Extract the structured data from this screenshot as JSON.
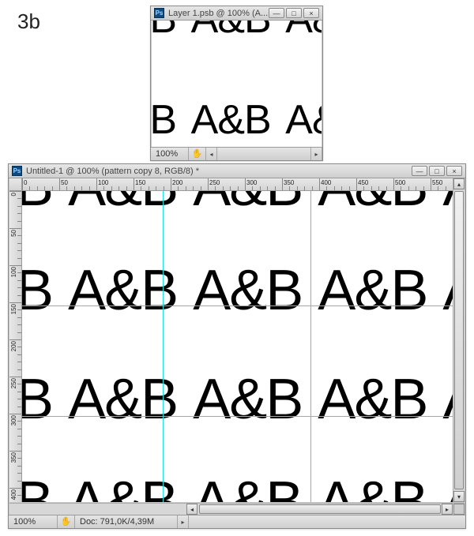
{
  "step_label": "3b",
  "pattern_text": "A&B",
  "small_window": {
    "title": "Layer 1.psb @ 100% (A...",
    "zoom": "100%"
  },
  "big_window": {
    "title": "Untitled-1 @ 100% (pattern copy 8, RGB/8) *",
    "zoom": "100%",
    "doc_info": "Doc: 791,0K/4,39M",
    "ruler_h_labels": [
      "0",
      "50",
      "100",
      "150",
      "200",
      "250",
      "300",
      "350",
      "400",
      "450",
      "500",
      "550"
    ],
    "ruler_v_labels": [
      "0",
      "50",
      "100",
      "150",
      "200",
      "250",
      "300",
      "350",
      "400"
    ]
  },
  "icons": {
    "ps": "Ps",
    "min": "—",
    "max": "□",
    "close": "×",
    "left": "◂",
    "right": "▸",
    "up": "▴",
    "down": "▾",
    "hand": "✋"
  }
}
